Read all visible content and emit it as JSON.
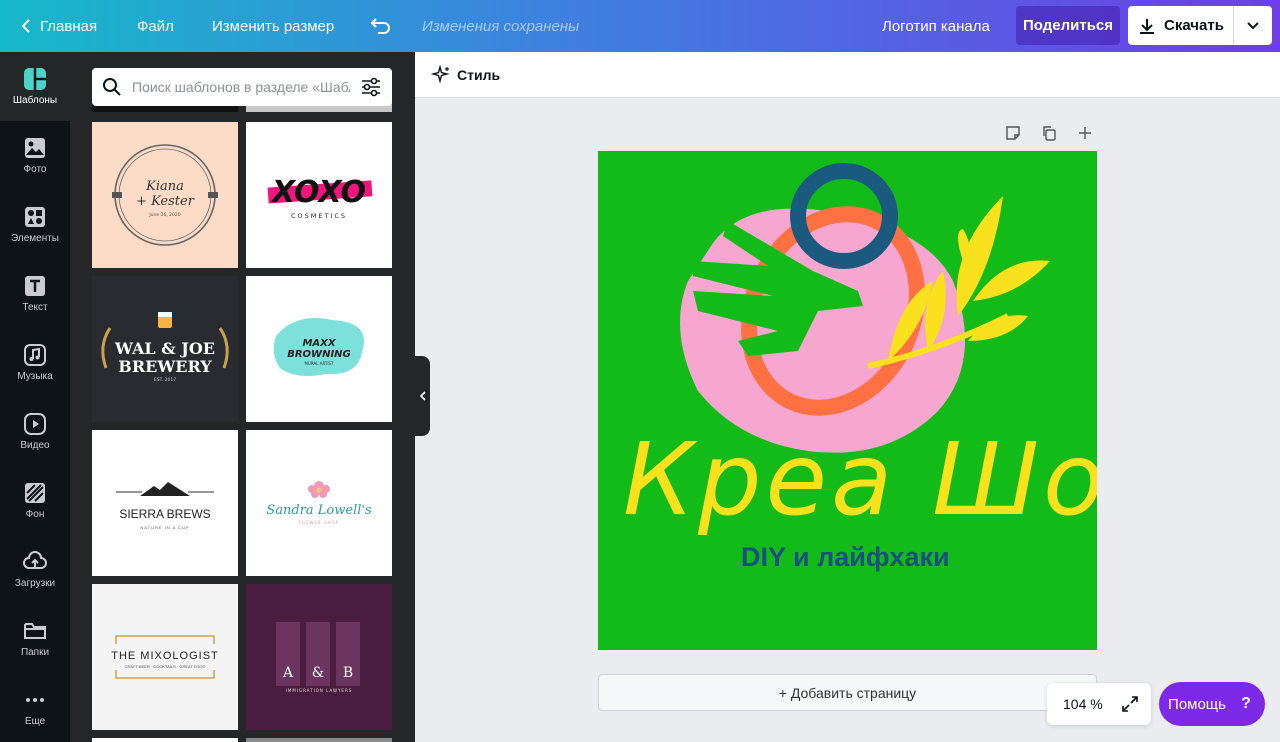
{
  "topbar": {
    "home": "Главная",
    "file": "Файл",
    "resize": "Изменить размер",
    "saved": "Изменения сохранены",
    "channel_logo": "Логотип канала",
    "share": "Поделиться",
    "download": "Скачать"
  },
  "rail": [
    {
      "label": "Шаблоны",
      "icon": "templates-icon"
    },
    {
      "label": "Фото",
      "icon": "photo-icon"
    },
    {
      "label": "Элементы",
      "icon": "elements-icon"
    },
    {
      "label": "Текст",
      "icon": "text-icon"
    },
    {
      "label": "Музыка",
      "icon": "music-icon"
    },
    {
      "label": "Видео",
      "icon": "video-icon"
    },
    {
      "label": "Фон",
      "icon": "background-icon"
    },
    {
      "label": "Загрузки",
      "icon": "upload-icon"
    },
    {
      "label": "Папки",
      "icon": "folder-icon"
    },
    {
      "label": "Еще",
      "icon": "more-icon"
    }
  ],
  "search": {
    "placeholder": "Поиск шаблонов в разделе «Шаблоны»"
  },
  "templates": {
    "kiana": {
      "line1": "Kiana",
      "line2": "+ Kester",
      "date": "June 26, 2020"
    },
    "xoxo": {
      "title": "XOXO",
      "sub": "COSMETICS"
    },
    "brewery": {
      "line1": "WAL & JOE",
      "line2": "BREWERY",
      "est": "EST. 2017"
    },
    "maxx": {
      "line1": "MAXX",
      "line2": "BROWNING",
      "sub": "MURAL ARTIST"
    },
    "sierra": {
      "title": "SIERRA BREWS",
      "sub": "NATURE IN A CUP"
    },
    "sandra": {
      "title": "Sandra Lowell's",
      "sub": "FLOWER SHOP"
    },
    "mixologist": {
      "title": "THE MIXOLOGIST",
      "sub": "CRAFT BEER · COCKTAILS · GREAT FOOD"
    },
    "ab": {
      "a": "A",
      "amp": "&",
      "b": "B",
      "sub": "IMMIGRATION LAWYERS"
    }
  },
  "editor": {
    "style_label": "Стиль",
    "design_title": "Креа Шоу",
    "design_subtitle": "DIY и лайфхаки",
    "add_page": "+ Добавить страницу",
    "zoom": "104 %",
    "help": "Помощь"
  },
  "colors": {
    "canvas_bg": "#13bb18",
    "accent_purple": "#7d2ae8",
    "title_yellow": "#f9e11d",
    "subtitle_blue": "#1a4f7e"
  }
}
